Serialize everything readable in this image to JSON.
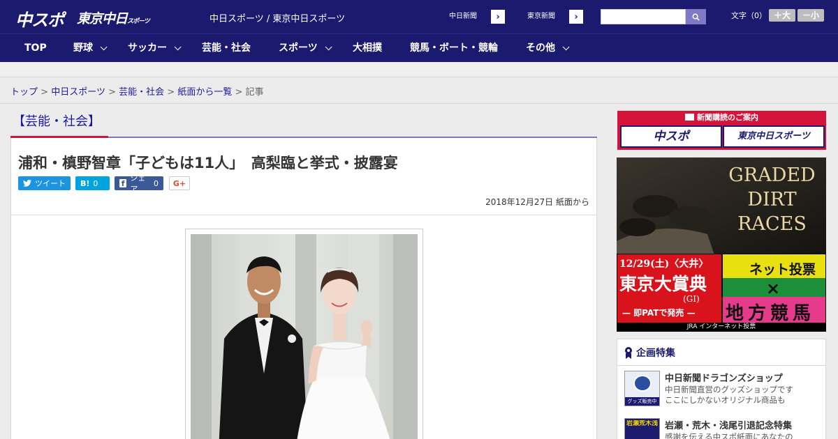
{
  "header": {
    "logo_main": "中スポ",
    "logo_tokyo": "東京中日",
    "logo_tokyo_small": "スポーツ",
    "site_name": "中日スポーツ / 東京中日スポーツ",
    "ext_links": [
      {
        "label": "中日新聞"
      },
      {
        "label": "東京新聞"
      }
    ],
    "search_placeholder": "",
    "text_size_label": "文字（0）",
    "text_larger": "＋大",
    "text_smaller": "－小"
  },
  "nav": {
    "items": [
      {
        "label": "TOP",
        "has_dropdown": false
      },
      {
        "label": "野球",
        "has_dropdown": true
      },
      {
        "label": "サッカー",
        "has_dropdown": true
      },
      {
        "label": "芸能・社会",
        "has_dropdown": false
      },
      {
        "label": "スポーツ",
        "has_dropdown": true
      },
      {
        "label": "大相撲",
        "has_dropdown": false
      },
      {
        "label": "競馬・ボート・競輪",
        "has_dropdown": false
      },
      {
        "label": "その他",
        "has_dropdown": true
      }
    ]
  },
  "breadcrumb": {
    "items": [
      "トップ",
      "中日スポーツ",
      "芸能・社会",
      "紙面から一覧"
    ],
    "current": "記事",
    "separator": ">"
  },
  "article": {
    "category": "【芸能・社会】",
    "headline": "浦和・槙野智章「子どもは11人」　高梨臨と挙式・披露宴",
    "share": {
      "tweet": "ツイート",
      "hatena_count": "0",
      "hatena_label": "B!",
      "facebook": "シェア",
      "facebook_count": "0",
      "google": "G+"
    },
    "date": "2018年12月27日 紙面から"
  },
  "sidebar": {
    "promo": {
      "heading": "新聞購読のご案内",
      "buttons": [
        "中スポ",
        "東京中日スポーツ"
      ]
    },
    "ad": {
      "headline": "GRADED DIRT RACES",
      "race_date": "12/29(土)〈大井〉",
      "race_name": "東京大賞典",
      "race_grade": "(GI)",
      "race_note": "— 即PATで発売 —",
      "net_vote": "ネット投票",
      "local": "地方競馬",
      "footer": "JRA インターネット投票"
    },
    "special": {
      "heading": "企画特集",
      "items": [
        {
          "title": "中日新聞ドラゴンズショップ",
          "desc": [
            "中日新聞直営のグッズショップです",
            "ここにしかないオリジナル商品も"
          ],
          "thumb_text": "グッズ販売中"
        },
        {
          "title": "岩瀬・荒木・浅尾引退記念特集",
          "desc": [
            "感謝を伝える中スポ紙面にあなたの"
          ],
          "thumb_text": "岩瀬荒木浅尾"
        }
      ]
    }
  },
  "colors": {
    "brand_navy": "#1c1a6e",
    "accent_red": "#d4143a",
    "link_blue": "#1c1a9e"
  }
}
